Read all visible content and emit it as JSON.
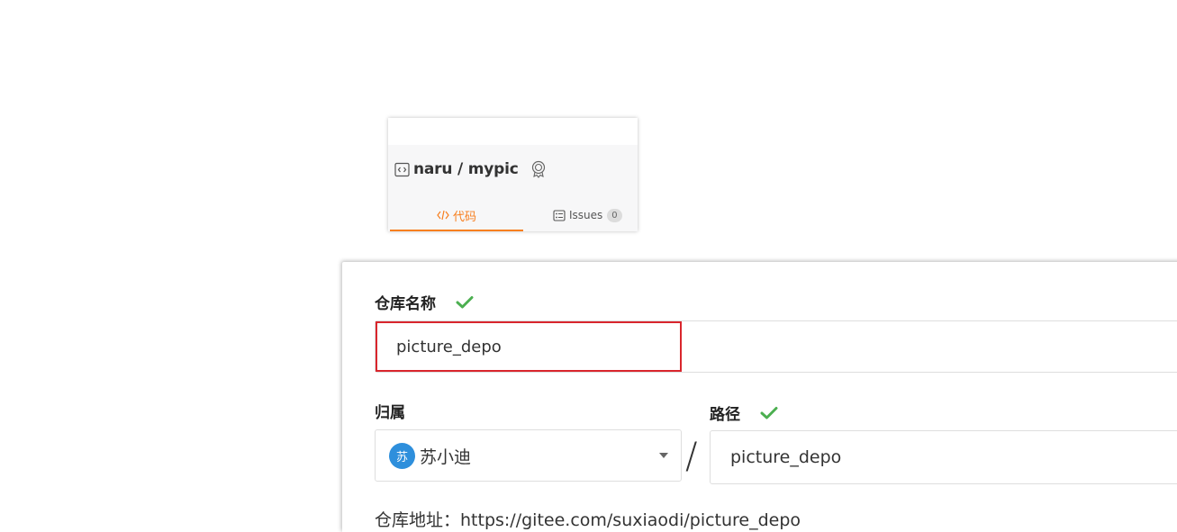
{
  "repo_card": {
    "repo_title": "naru / mypic",
    "tabs": {
      "code_label": "代码",
      "issues_label": "Issues",
      "issues_count": "0"
    }
  },
  "form": {
    "repo_name_label": "仓库名称",
    "repo_name_value": "picture_depo",
    "owner_label": "归属",
    "owner_avatar_text": "苏",
    "owner_value": "苏小迪",
    "path_separator": "/",
    "path_label": "路径",
    "path_value": "picture_depo",
    "repo_url_text": "仓库地址：https://gitee.com/suxiaodi/picture_depo"
  },
  "colors": {
    "accent_orange": "#f77f1f",
    "highlight_red": "#d9262d",
    "check_green": "#4caf50",
    "avatar_blue": "#2e8fdc"
  }
}
